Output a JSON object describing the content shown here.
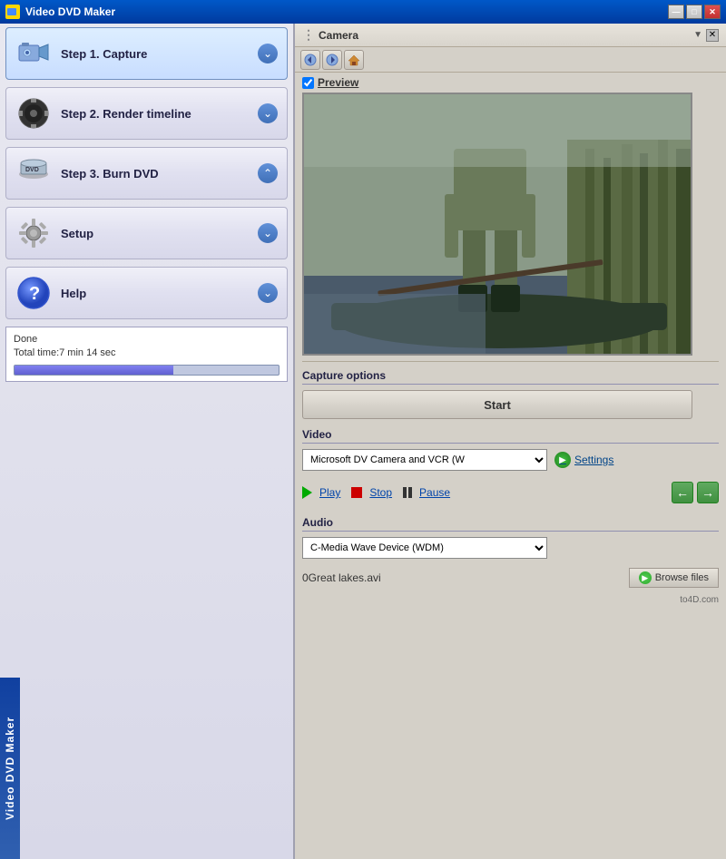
{
  "app": {
    "title": "Video DVD Maker",
    "titlebar_buttons": {
      "minimize": "—",
      "maximize": "□",
      "close": "✕"
    }
  },
  "sidebar": {
    "items": [
      {
        "id": "step1",
        "label": "Step 1. Capture",
        "icon": "camera"
      },
      {
        "id": "step2",
        "label": "Step 2. Render timeline",
        "icon": "film"
      },
      {
        "id": "step3",
        "label": "Step 3. Burn DVD",
        "icon": "dvd"
      },
      {
        "id": "setup",
        "label": "Setup",
        "icon": "gear"
      },
      {
        "id": "help",
        "label": "Help",
        "icon": "help"
      }
    ],
    "vertical_label": "Video DVD Maker",
    "status": {
      "line1": "Done",
      "line2": "Total time:7 min 14 sec"
    }
  },
  "camera_panel": {
    "title": "Camera",
    "nav_back": "◀",
    "nav_forward": "▶",
    "nav_home": "⌂",
    "preview_checked": true,
    "preview_label": "Preview"
  },
  "capture_options": {
    "section_title": "Capture options",
    "start_button": "Start"
  },
  "video": {
    "section_title": "Video",
    "device": "Microsoft DV Camera and VCR (W",
    "settings_label": "Settings",
    "play_label": "Play",
    "stop_label": "Stop",
    "pause_label": "Pause"
  },
  "audio": {
    "section_title": "Audio",
    "device": "C-Media Wave Device (WDM)"
  },
  "file": {
    "filename": "0Great lakes.avi",
    "browse_label": "Browse files"
  },
  "watermark": "to4D.com"
}
